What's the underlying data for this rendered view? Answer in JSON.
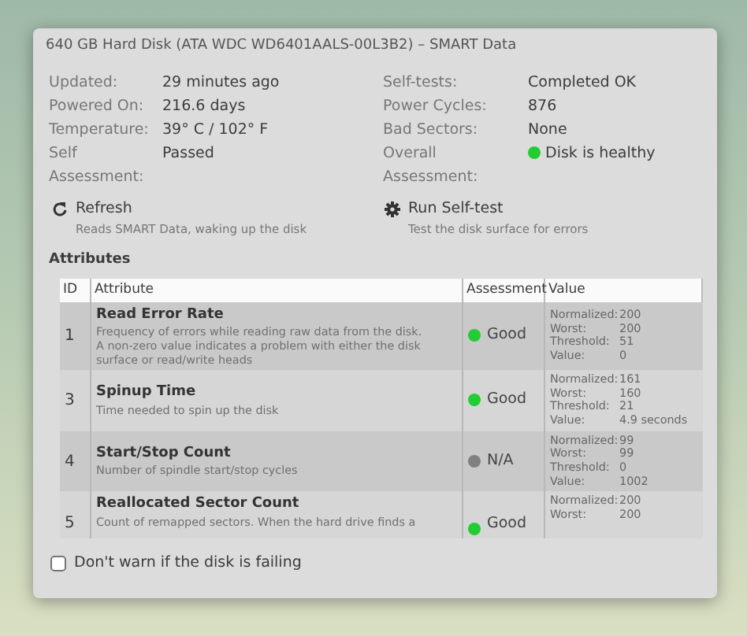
{
  "window": {
    "title": "640 GB Hard Disk (ATA WDC WD6401AALS-00L3B2) – SMART Data"
  },
  "info_left": [
    {
      "label": "Updated:",
      "value": "29 minutes ago"
    },
    {
      "label": "Powered On:",
      "value": "216.6 days"
    },
    {
      "label": "Temperature:",
      "value": "39° C / 102° F"
    },
    {
      "label": "Self Assessment:",
      "value": "Passed"
    }
  ],
  "info_right": [
    {
      "label": "Self-tests:",
      "value": "Completed OK"
    },
    {
      "label": "Power Cycles:",
      "value": "876"
    },
    {
      "label": "Bad Sectors:",
      "value": "None"
    },
    {
      "label": "Overall Assessment:",
      "value": "Disk is healthy",
      "color": "#22cc33"
    }
  ],
  "actions": [
    {
      "kind": "refresh",
      "title": "Refresh",
      "subtitle": "Reads SMART Data, waking up the disk"
    },
    {
      "kind": "selftest",
      "title": "Run Self-test",
      "subtitle": "Test the disk surface for errors"
    }
  ],
  "attributes": {
    "heading": "Attributes",
    "columns": [
      "ID",
      "Attribute",
      "Assessment",
      "Value"
    ],
    "rows": [
      {
        "id": "1",
        "name": "Read Error Rate",
        "description": [
          "Frequency of errors while reading raw data from the disk.",
          "A non-zero value indicates a problem with either the disk",
          "surface or read/write heads"
        ],
        "assessment": "Good",
        "color": "#22cc33",
        "values": [
          [
            "Normalized:",
            "200"
          ],
          [
            "Worst:",
            "200"
          ],
          [
            "Threshold:",
            "51"
          ],
          [
            "Value:",
            "0"
          ]
        ]
      },
      {
        "id": "3",
        "name": "Spinup Time",
        "description": [
          "Time needed to spin up the disk"
        ],
        "assessment": "Good",
        "color": "#22cc33",
        "values": [
          [
            "Normalized:",
            "161"
          ],
          [
            "Worst:",
            "160"
          ],
          [
            "Threshold:",
            "21"
          ],
          [
            "Value:",
            "4.9 seconds"
          ]
        ]
      },
      {
        "id": "4",
        "name": "Start/Stop Count",
        "description": [
          "Number of spindle start/stop cycles"
        ],
        "assessment": "N/A",
        "color": "#808080",
        "values": [
          [
            "Normalized:",
            "99"
          ],
          [
            "Worst:",
            "99"
          ],
          [
            "Threshold:",
            "0"
          ],
          [
            "Value:",
            "1002"
          ]
        ]
      },
      {
        "id": "5",
        "name": "Reallocated Sector Count",
        "description": [
          "Count of remapped sectors. When the hard drive finds a"
        ],
        "assessment": "Good",
        "color": "#22cc33",
        "values": [
          [
            "Normalized:",
            "200"
          ],
          [
            "Worst:",
            "200"
          ]
        ]
      }
    ]
  },
  "option": {
    "label": "Don't warn if the disk is failing",
    "checked": false
  }
}
